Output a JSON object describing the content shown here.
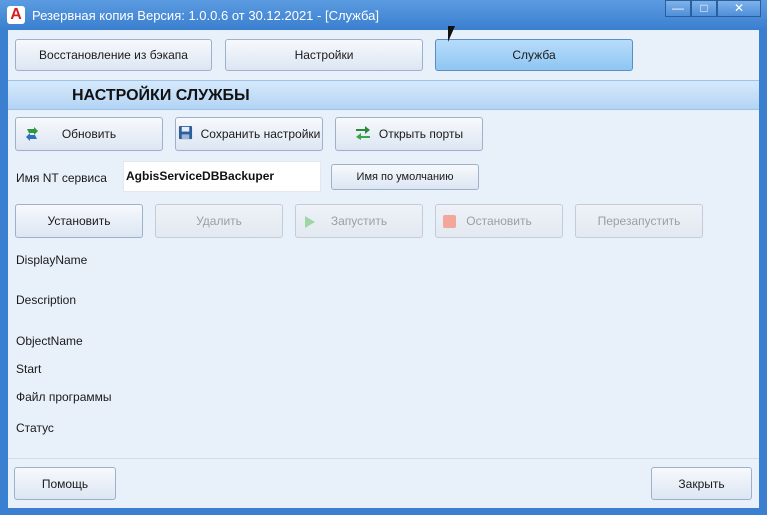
{
  "window": {
    "title": "Резервная копия   Версия: 1.0.0.6 от 30.12.2021 - [Служба]",
    "app_icon_glyph": "A",
    "minimize_glyph": "—",
    "maximize_glyph": "□",
    "close_glyph": "✕"
  },
  "tabs": [
    {
      "label": "Восстановление из бэкапа",
      "active": false
    },
    {
      "label": "Настройки",
      "active": false
    },
    {
      "label": "Служба",
      "active": true
    }
  ],
  "section": {
    "title": "НАСТРОЙКИ СЛУЖБЫ"
  },
  "toolbar": {
    "refresh_label": "Обновить",
    "save_label": "Сохранить настройки",
    "ports_label": "Открыть порты"
  },
  "nt_service": {
    "label": "Имя NT сервиса",
    "value": "AgbisServiceDBBackuper",
    "default_button": "Имя по умолчанию"
  },
  "service_actions": {
    "install": "Установить",
    "remove": "Удалить",
    "start": "Запустить",
    "stop": "Остановить",
    "restart": "Перезапустить"
  },
  "properties": {
    "display_name": "DisplayName",
    "description": "Description",
    "object_name": "ObjectName",
    "start": "Start",
    "program_file": "Файл программы",
    "status": "Статус"
  },
  "footer": {
    "help_label": "Помощь",
    "close_label": "Закрыть"
  },
  "colors": {
    "accent": "#3a7fd0",
    "active_tab": "#a6d1f6",
    "client_bg": "#e8f0fa"
  }
}
